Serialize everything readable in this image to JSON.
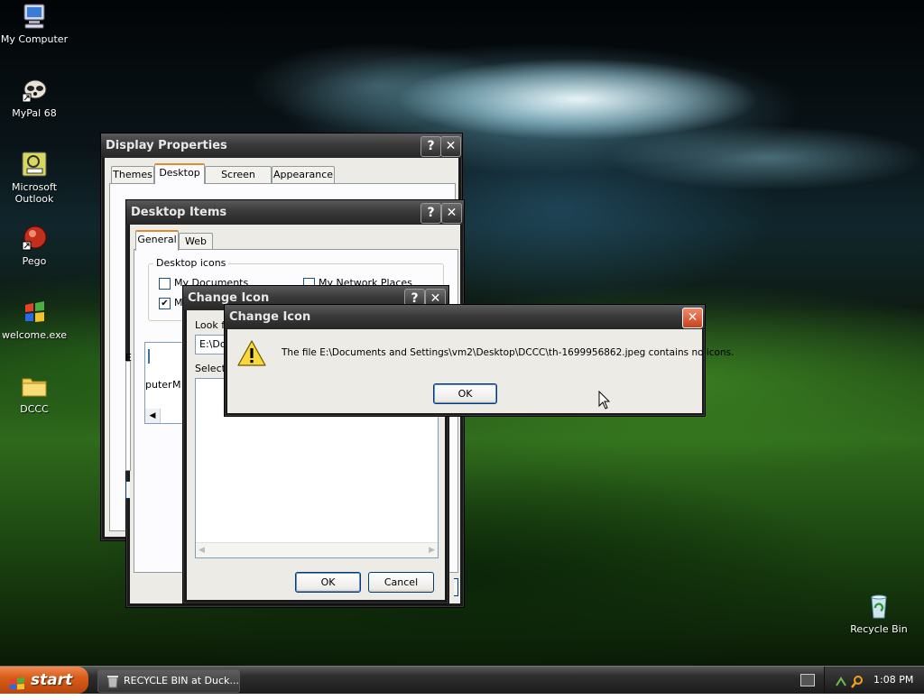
{
  "desktop": {
    "icons": [
      {
        "label": "My Computer"
      },
      {
        "label": "MyPal 68"
      },
      {
        "label": "Microsoft Outlook"
      },
      {
        "label": "Pego"
      },
      {
        "label": "welcome.exe"
      },
      {
        "label": "DCCC"
      },
      {
        "label": "Recycle Bin"
      }
    ]
  },
  "display_properties": {
    "title": "Display Properties",
    "tabs": [
      "Themes",
      "Desktop",
      "Screen Saver",
      "Appearance"
    ],
    "selected_tab": "Desktop"
  },
  "desktop_items": {
    "title": "Desktop Items",
    "tabs": [
      "General",
      "Web"
    ],
    "group_label": "Desktop icons",
    "checkboxes": [
      {
        "label": "My Documents",
        "checked": false
      },
      {
        "label": "My Network Places",
        "checked": false
      },
      {
        "label": "My",
        "checked": true
      }
    ],
    "list_partial_labels": [
      "puter",
      "M"
    ],
    "partial_label_E": "E"
  },
  "change_icon_bg": {
    "title": "Change Icon",
    "look_for_label": "Look fo",
    "path_value": "E:\\Do",
    "select_label": "Select",
    "ok_label": "OK",
    "cancel_label": "Cancel"
  },
  "alert": {
    "title": "Change Icon",
    "message": "The file E:\\Documents and Settings\\vm2\\Desktop\\DCCC\\th-1699956862.jpeg contains no icons.",
    "ok_label": "OK"
  },
  "taskbar": {
    "start_label": "start",
    "task_label": "RECYCLE BIN at Duck...",
    "clock": "1:08 PM"
  }
}
